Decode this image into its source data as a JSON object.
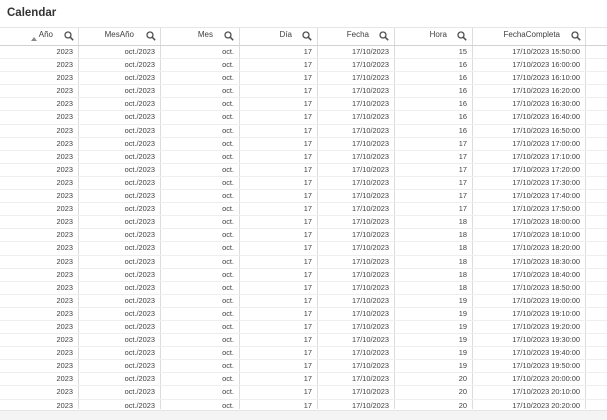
{
  "title": "Calendar",
  "columns": [
    {
      "label": "Año",
      "sorted": "ascending"
    },
    {
      "label": "MesAño"
    },
    {
      "label": "Mes"
    },
    {
      "label": "Día"
    },
    {
      "label": "Fecha"
    },
    {
      "label": "Hora"
    },
    {
      "label": "FechaCompleta"
    }
  ],
  "icons": {
    "search": "search-icon",
    "sort": "sort-ascending-icon"
  },
  "rows": [
    [
      "2023",
      "oct./2023",
      "oct.",
      "17",
      "17/10/2023",
      "15",
      "17/10/2023 15:50:00"
    ],
    [
      "2023",
      "oct./2023",
      "oct.",
      "17",
      "17/10/2023",
      "16",
      "17/10/2023 16:00:00"
    ],
    [
      "2023",
      "oct./2023",
      "oct.",
      "17",
      "17/10/2023",
      "16",
      "17/10/2023 16:10:00"
    ],
    [
      "2023",
      "oct./2023",
      "oct.",
      "17",
      "17/10/2023",
      "16",
      "17/10/2023 16:20:00"
    ],
    [
      "2023",
      "oct./2023",
      "oct.",
      "17",
      "17/10/2023",
      "16",
      "17/10/2023 16:30:00"
    ],
    [
      "2023",
      "oct./2023",
      "oct.",
      "17",
      "17/10/2023",
      "16",
      "17/10/2023 16:40:00"
    ],
    [
      "2023",
      "oct./2023",
      "oct.",
      "17",
      "17/10/2023",
      "16",
      "17/10/2023 16:50:00"
    ],
    [
      "2023",
      "oct./2023",
      "oct.",
      "17",
      "17/10/2023",
      "17",
      "17/10/2023 17:00:00"
    ],
    [
      "2023",
      "oct./2023",
      "oct.",
      "17",
      "17/10/2023",
      "17",
      "17/10/2023 17:10:00"
    ],
    [
      "2023",
      "oct./2023",
      "oct.",
      "17",
      "17/10/2023",
      "17",
      "17/10/2023 17:20:00"
    ],
    [
      "2023",
      "oct./2023",
      "oct.",
      "17",
      "17/10/2023",
      "17",
      "17/10/2023 17:30:00"
    ],
    [
      "2023",
      "oct./2023",
      "oct.",
      "17",
      "17/10/2023",
      "17",
      "17/10/2023 17:40:00"
    ],
    [
      "2023",
      "oct./2023",
      "oct.",
      "17",
      "17/10/2023",
      "17",
      "17/10/2023 17:50:00"
    ],
    [
      "2023",
      "oct./2023",
      "oct.",
      "17",
      "17/10/2023",
      "18",
      "17/10/2023 18:00:00"
    ],
    [
      "2023",
      "oct./2023",
      "oct.",
      "17",
      "17/10/2023",
      "18",
      "17/10/2023 18:10:00"
    ],
    [
      "2023",
      "oct./2023",
      "oct.",
      "17",
      "17/10/2023",
      "18",
      "17/10/2023 18:20:00"
    ],
    [
      "2023",
      "oct./2023",
      "oct.",
      "17",
      "17/10/2023",
      "18",
      "17/10/2023 18:30:00"
    ],
    [
      "2023",
      "oct./2023",
      "oct.",
      "17",
      "17/10/2023",
      "18",
      "17/10/2023 18:40:00"
    ],
    [
      "2023",
      "oct./2023",
      "oct.",
      "17",
      "17/10/2023",
      "18",
      "17/10/2023 18:50:00"
    ],
    [
      "2023",
      "oct./2023",
      "oct.",
      "17",
      "17/10/2023",
      "19",
      "17/10/2023 19:00:00"
    ],
    [
      "2023",
      "oct./2023",
      "oct.",
      "17",
      "17/10/2023",
      "19",
      "17/10/2023 19:10:00"
    ],
    [
      "2023",
      "oct./2023",
      "oct.",
      "17",
      "17/10/2023",
      "19",
      "17/10/2023 19:20:00"
    ],
    [
      "2023",
      "oct./2023",
      "oct.",
      "17",
      "17/10/2023",
      "19",
      "17/10/2023 19:30:00"
    ],
    [
      "2023",
      "oct./2023",
      "oct.",
      "17",
      "17/10/2023",
      "19",
      "17/10/2023 19:40:00"
    ],
    [
      "2023",
      "oct./2023",
      "oct.",
      "17",
      "17/10/2023",
      "19",
      "17/10/2023 19:50:00"
    ],
    [
      "2023",
      "oct./2023",
      "oct.",
      "17",
      "17/10/2023",
      "20",
      "17/10/2023 20:00:00"
    ],
    [
      "2023",
      "oct./2023",
      "oct.",
      "17",
      "17/10/2023",
      "20",
      "17/10/2023 20:10:00"
    ],
    [
      "2023",
      "oct./2023",
      "oct.",
      "17",
      "17/10/2023",
      "20",
      "17/10/2023 20:20:00"
    ]
  ]
}
